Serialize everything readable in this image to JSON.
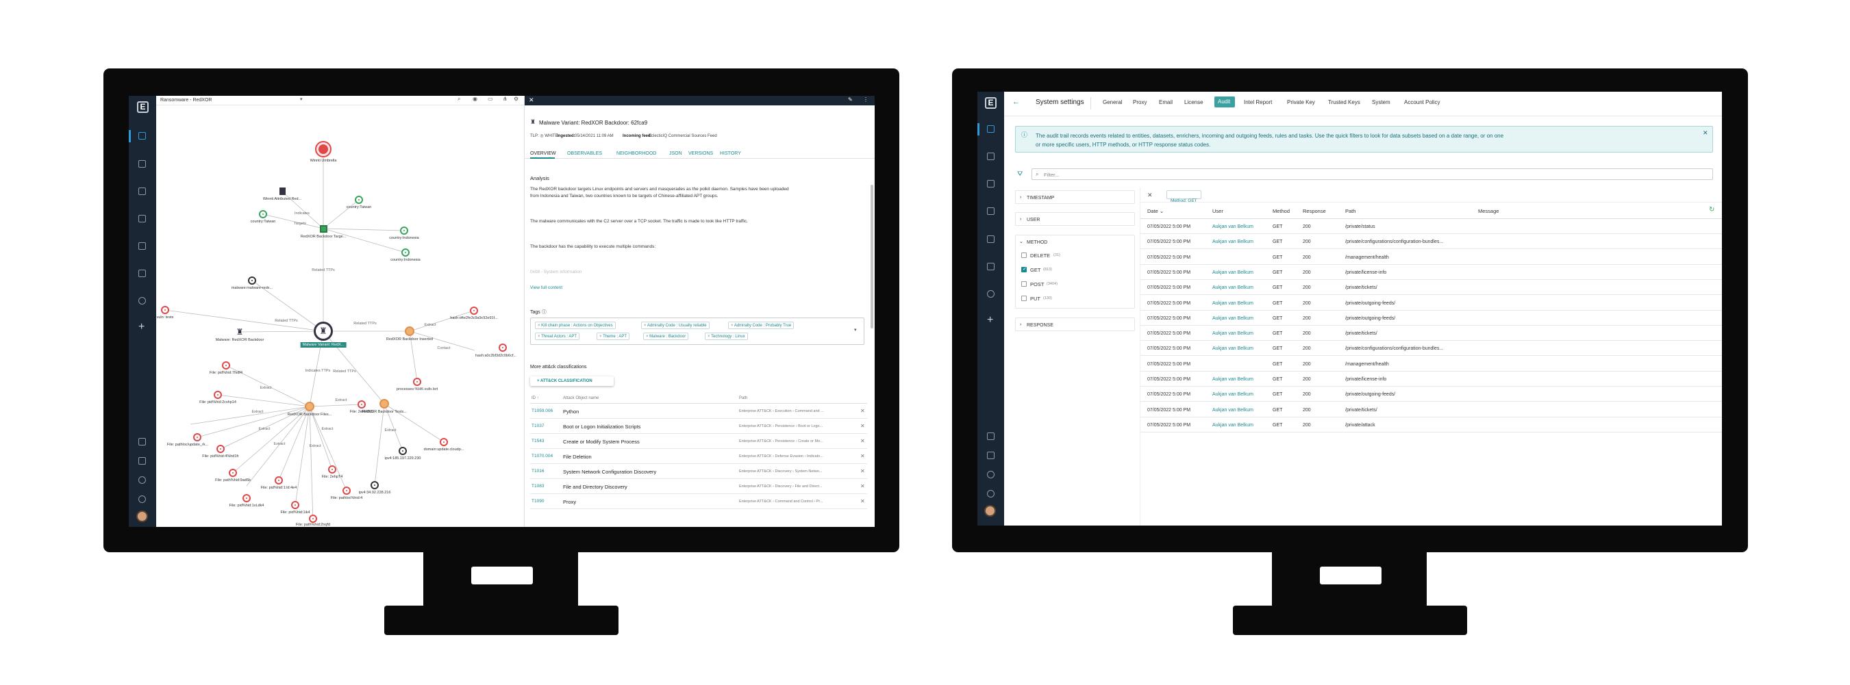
{
  "left_app": {
    "nav_logo": "E",
    "graph_header": {
      "title": "Ransomware - RedXOR"
    },
    "graph_nodes": [
      {
        "label": "Winnti Umbrella",
        "kind": "red"
      },
      {
        "label": "Winnti Attributed Red...",
        "kind": "doc"
      },
      {
        "label": "country:Taiwan",
        "kind": "green"
      },
      {
        "label": "country:Taiwan",
        "kind": "green"
      },
      {
        "label": "country:Indonesia",
        "kind": "green"
      },
      {
        "label": "country:Indonesia",
        "kind": "green"
      },
      {
        "label": "RedXOR Backdoor Targe...",
        "kind": "green"
      },
      {
        "label": "malware:malware-redx...",
        "kind": "black"
      },
      {
        "label": "Malware: RedXOR Backdoor",
        "kind": "malware"
      },
      {
        "label": "Malware Variant: RedX...",
        "kind": "selected"
      },
      {
        "label": "RedXOR Backdoor Inserted",
        "kind": "orange"
      },
      {
        "label": "RedXOR Backdoor Tests...",
        "kind": "orange"
      },
      {
        "label": "RedXOR Backdoor Files...",
        "kind": "orange"
      },
      {
        "label": "hash:d4e2fe3c9a9c92e91f...",
        "kind": "red"
      },
      {
        "label": "hash:a0c2bf3d2c0b6cf...",
        "kind": "red"
      },
      {
        "label": "processes:%HK-xufo.lsrt",
        "kind": "red"
      },
      {
        "label": "File: pid%hid:7fsdf4",
        "kind": "red"
      },
      {
        "label": "File: pid%hid:2cshp14",
        "kind": "red"
      },
      {
        "label": "File: 2ef4RNS",
        "kind": "red"
      },
      {
        "label": "domain:update.cloudp...",
        "kind": "red"
      },
      {
        "label": "ipv4:185.197.229.230",
        "kind": "black"
      },
      {
        "label": "ipv4:34.92.228.216",
        "kind": "black"
      },
      {
        "label": "File: 2ehpT4",
        "kind": "red"
      },
      {
        "label": "File: pathloc/update_rk...",
        "kind": "red"
      },
      {
        "label": "File: pid%hid:4%hd1fr",
        "kind": "red"
      },
      {
        "label": "File: path%hid:9ad6b",
        "kind": "red"
      },
      {
        "label": "File: pid%hid:1:ld:4e4",
        "kind": "red"
      },
      {
        "label": "File: pid%hid:1xLdk4",
        "kind": "red"
      },
      {
        "label": "File: pid%hid:1ik4",
        "kind": "red"
      },
      {
        "label": "File: pathloc%hid:4",
        "kind": "red"
      },
      {
        "label": "File: path%hid:2nqfd",
        "kind": "red"
      },
      {
        "label": "vuln: tests",
        "kind": "red"
      }
    ],
    "edge_labels": [
      "Targets",
      "Indicates",
      "Related TTPs",
      "Related TTPs",
      "Related TTPs",
      "Related TTPs",
      "Indicates TTPs",
      "Extract",
      "Extract",
      "Extract",
      "Extract",
      "Extract",
      "Extract",
      "Extract",
      "Extract",
      "Extract",
      "Contact"
    ],
    "detail": {
      "heading": "Malware Variant: RedXOR Backdoor: 62fca9",
      "tlp": "TLP: ◎ WHITE",
      "ingested_label": "Ingested:",
      "ingested_value": "05/14/2021 11:09 AM",
      "feed_label": "Incoming feed:",
      "feed_value": "EclecticIQ Commercial Sources Feed",
      "tabs": [
        "OVERVIEW",
        "OBSERVABLES",
        "NEIGHBORHOOD",
        "JSON",
        "VERSIONS",
        "HISTORY"
      ],
      "analysis_title": "Analysis",
      "analysis_p1": "The RedXOR backdoor targets Linux endpoints and servers and masquerades as the polkit daemon. Samples have been uploaded",
      "analysis_p1b": "from Indonesia and Taiwan, two countries known to be targets of Chinese-affiliated APT groups.",
      "analysis_p2": "The malware communicates with the C2 server over a TCP socket. The traffic is made to look like HTTP traffic.",
      "analysis_p3": "The backdoor has the capability to execute multiple commands:",
      "analysis_faded": "0x08 - System information",
      "view_full": "View full content",
      "tags_title": "Tags ⓘ",
      "tags": [
        "Kill chain phase : Actions on Objectives",
        "Admiralty Code : Usually reliable",
        "Admiralty Code : Probably True",
        "Threat Actors : APT",
        "Theme : APT",
        "Malware : Backdoor",
        "Technology : Linux"
      ],
      "attack_title": "More att&ck classifications",
      "attack_button": "+ ATT&CK CLASSIFICATION",
      "columns": [
        "ID ↑",
        "Attack Object name",
        "Path"
      ],
      "rows": [
        {
          "id": "T1059.006",
          "name": "Python",
          "path": "Enterprise ATT&CK › Execution › Command and ..."
        },
        {
          "id": "T1037",
          "name": "Boot or Logon Initialization Scripts",
          "path": "Enterprise ATT&CK › Persistence › Boot or Logo..."
        },
        {
          "id": "T1543",
          "name": "Create or Modify System Process",
          "path": "Enterprise ATT&CK › Persistence › Create or Mo..."
        },
        {
          "id": "T1070.004",
          "name": "File Deletion",
          "path": "Enterprise ATT&CK › Defense Evasion › Indicato..."
        },
        {
          "id": "T1016",
          "name": "System Network Configuration Discovery",
          "path": "Enterprise ATT&CK › Discovery › System Netwo..."
        },
        {
          "id": "T1083",
          "name": "File and Directory Discovery",
          "path": "Enterprise ATT&CK › Discovery › File and Direct..."
        },
        {
          "id": "T1090",
          "name": "Proxy",
          "path": "Enterprise ATT&CK › Command and Control › Pr..."
        }
      ]
    }
  },
  "right_app": {
    "nav_logo": "E",
    "page_title": "System settings",
    "back_icon": "←",
    "tabs": [
      "General",
      "Proxy",
      "Email",
      "License",
      "Audit",
      "Intel Report",
      "Private Key",
      "Trusted Keys",
      "System",
      "Account Policy"
    ],
    "active_tab": "Audit",
    "info_text_1": "The audit trail records events related to entities, datasets, enrichers, incoming and outgoing feeds, rules and tasks. Use the quick filters to look for data subsets based on a date range, or on one",
    "info_text_2": "or more specific users, HTTP methods, or HTTP response status codes.",
    "filter_placeholder": "Filter...",
    "facets": {
      "timestamp": "TIMESTAMP",
      "user": "USER",
      "method": "METHOD",
      "response": "RESPONSE",
      "options": [
        {
          "label": "DELETE",
          "count": "(31)",
          "checked": false
        },
        {
          "label": "GET",
          "count": "(813)",
          "checked": true
        },
        {
          "label": "POST",
          "count": "(3404)",
          "checked": false
        },
        {
          "label": "PUT",
          "count": "(130)",
          "checked": false
        }
      ]
    },
    "active_filter": "Method: GET",
    "columns": [
      "Date ⌄",
      "User",
      "Method",
      "Response",
      "Path",
      "Message"
    ],
    "rows": [
      {
        "date": "07/05/2022 5:00 PM",
        "user": "Aukjan van Belkum",
        "method": "GET",
        "response": "200",
        "path": "/private/status"
      },
      {
        "date": "07/05/2022 5:00 PM",
        "user": "Aukjan van Belkum",
        "method": "GET",
        "response": "200",
        "path": "/private/configurations/configuration-bundles..."
      },
      {
        "date": "07/05/2022 5:00 PM",
        "user": "",
        "method": "GET",
        "response": "200",
        "path": "/management/health"
      },
      {
        "date": "07/05/2022 5:00 PM",
        "user": "Aukjan van Belkum",
        "method": "GET",
        "response": "200",
        "path": "/private/license-info"
      },
      {
        "date": "07/05/2022 5:00 PM",
        "user": "Aukjan van Belkum",
        "method": "GET",
        "response": "200",
        "path": "/private/tickets/"
      },
      {
        "date": "07/05/2022 5:00 PM",
        "user": "Aukjan van Belkum",
        "method": "GET",
        "response": "200",
        "path": "/private/outgoing-feeds/"
      },
      {
        "date": "07/05/2022 5:00 PM",
        "user": "Aukjan van Belkum",
        "method": "GET",
        "response": "200",
        "path": "/private/outgoing-feeds/"
      },
      {
        "date": "07/05/2022 5:00 PM",
        "user": "Aukjan van Belkum",
        "method": "GET",
        "response": "200",
        "path": "/private/tickets/"
      },
      {
        "date": "07/05/2022 5:00 PM",
        "user": "Aukjan van Belkum",
        "method": "GET",
        "response": "200",
        "path": "/private/configurations/configuration-bundles..."
      },
      {
        "date": "07/05/2022 5:00 PM",
        "user": "",
        "method": "GET",
        "response": "200",
        "path": "/management/health"
      },
      {
        "date": "07/05/2022 5:00 PM",
        "user": "Aukjan van Belkum",
        "method": "GET",
        "response": "200",
        "path": "/private/license-info"
      },
      {
        "date": "07/05/2022 5:00 PM",
        "user": "Aukjan van Belkum",
        "method": "GET",
        "response": "200",
        "path": "/private/outgoing-feeds/"
      },
      {
        "date": "07/05/2022 5:00 PM",
        "user": "Aukjan van Belkum",
        "method": "GET",
        "response": "200",
        "path": "/private/tickets/"
      },
      {
        "date": "07/05/2022 5:00 PM",
        "user": "Aukjan van Belkum",
        "method": "GET",
        "response": "200",
        "path": "/private/attack"
      }
    ]
  }
}
